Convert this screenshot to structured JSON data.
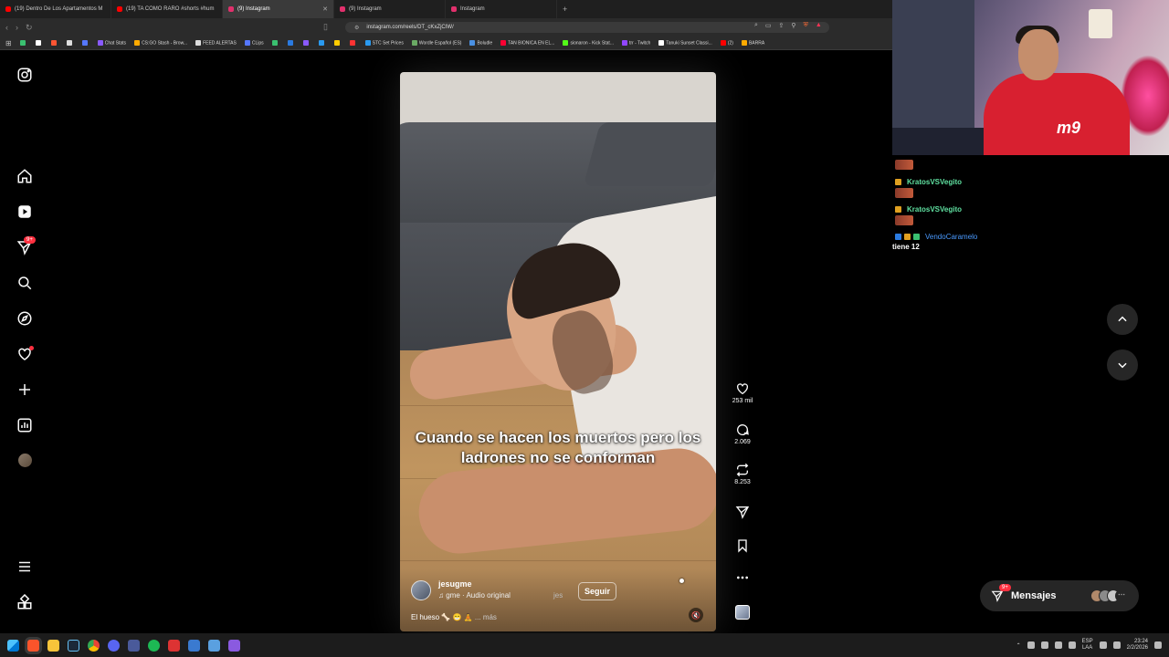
{
  "browser": {
    "tabs": [
      {
        "label": "(19) Dentro De Los Apartamentos M",
        "color": "#ff0000"
      },
      {
        "label": "(19) TA COMO RARO #shorts #hum",
        "color": "#ff0000"
      },
      {
        "label": "(9) Instagram",
        "color": "#e1306c"
      },
      {
        "label": "(9) Instagram",
        "color": "#e1306c"
      },
      {
        "label": "Instagram",
        "color": "#e1306c"
      }
    ],
    "new_tab": "+",
    "url": "instagram.com/reels/DT_cKxZjCIW/",
    "bookmarks": [
      {
        "label": "",
        "color": "#3ac070"
      },
      {
        "label": "",
        "color": "#ffffff"
      },
      {
        "label": "",
        "color": "#ff5533"
      },
      {
        "label": "",
        "color": "#dddddd"
      },
      {
        "label": "",
        "color": "#5577ff"
      },
      {
        "label": "Chat Stats",
        "color": "#8a5aff"
      },
      {
        "label": "CS:GO Stash - Brow...",
        "color": "#ffaa00"
      },
      {
        "label": "FEED ALERTAS",
        "color": "#dddddd"
      },
      {
        "label": "CLips",
        "color": "#5577ff"
      },
      {
        "label": "",
        "color": "#3ac070"
      },
      {
        "label": "",
        "color": "#2a7ae0"
      },
      {
        "label": "",
        "color": "#8a5aff"
      },
      {
        "label": "",
        "color": "#2a9af0"
      },
      {
        "label": "",
        "color": "#ffcc00"
      },
      {
        "label": "",
        "color": "#ff3333"
      },
      {
        "label": "STC Set Prices",
        "color": "#2a9af0"
      },
      {
        "label": "Wordle Español (ES)",
        "color": "#6aaa64"
      },
      {
        "label": "Boludle",
        "color": "#4a90e2"
      },
      {
        "label": "TAN BIONICA EN EL...",
        "color": "#ff0033"
      },
      {
        "label": "sionaron - Kick Stat...",
        "color": "#53fc18"
      },
      {
        "label": "trr - Twitch",
        "color": "#9146ff"
      },
      {
        "label": "Tanuki Sunset Classi...",
        "color": "#ffffff"
      },
      {
        "label": "(2)",
        "color": "#ff0000"
      },
      {
        "label": "BARRA",
        "color": "#ffaa00"
      }
    ]
  },
  "instagram": {
    "nav_badge": "9+",
    "reel": {
      "caption": "Cuando se hacen los muertos pero los ladrones no se conforman",
      "author": "jesugme",
      "audio": "♫ gme · Audio original",
      "tagged": "jes",
      "follow": "Seguir",
      "description": "El hueso 🦴 😁 🧘",
      "more": "... más"
    },
    "actions": {
      "likes": "253 mil",
      "comments": "2.069",
      "reposts": "8.253"
    },
    "messages": {
      "label": "Mensajes",
      "badge": "9+"
    }
  },
  "stream_chat": {
    "messages": [
      {
        "user": "KratosVSVegito"
      },
      {
        "user": "KratosVSVegito"
      },
      {
        "user": "VendoCaramelo"
      }
    ],
    "text": "tiene 12",
    "jersey_text": "m9"
  },
  "taskbar": {
    "language": "ESP",
    "layout": "LAA",
    "time": "23:24",
    "date": "2/2/2026"
  }
}
